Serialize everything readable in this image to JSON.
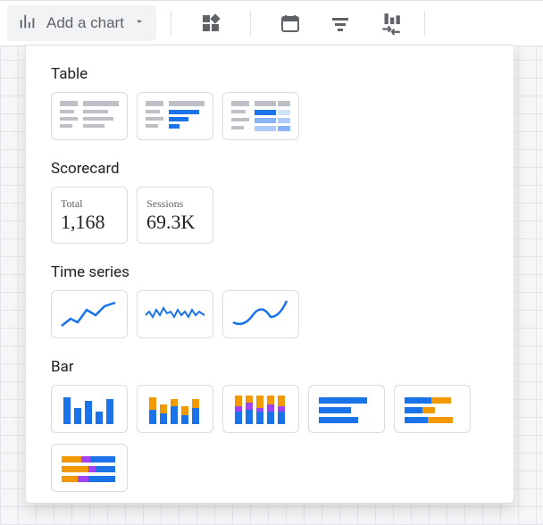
{
  "toolbar": {
    "add_chart_label": "Add a chart"
  },
  "dropdown": {
    "sections": {
      "table": {
        "label": "Table"
      },
      "scorecard": {
        "label": "Scorecard",
        "cards": [
          {
            "label": "Total",
            "value": "1,168"
          },
          {
            "label": "Sessions",
            "value": "69.3K"
          }
        ]
      },
      "timeseries": {
        "label": "Time series"
      },
      "bar": {
        "label": "Bar"
      }
    }
  }
}
